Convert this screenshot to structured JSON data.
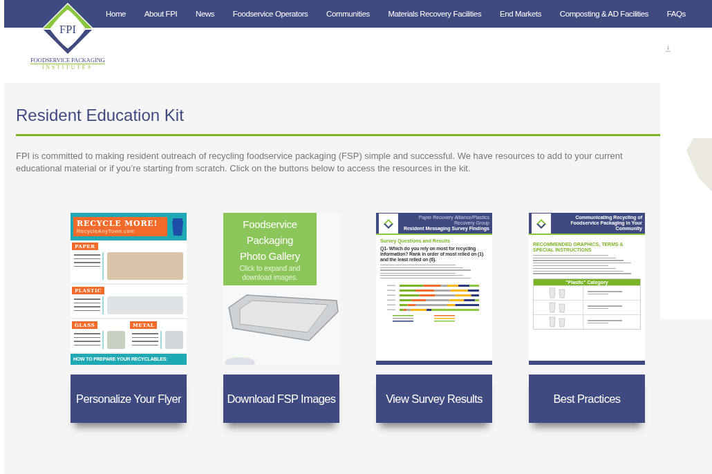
{
  "nav": {
    "logo": {
      "mark": "FPI",
      "name": "FOODSERVICE PACKAGING",
      "tagline": "INSTITUTE®"
    },
    "items": [
      "Home",
      "About FPI",
      "News",
      "Foodservice Operators",
      "Communities",
      "Materials Recovery Facilities",
      "End Markets",
      "Composting & AD Facilities",
      "FAQs"
    ]
  },
  "page": {
    "title": "Resident Education Kit",
    "intro": "FPI is committed to making resident outreach of recycling foodservice packaging (FSP) simple and successful. We have resources to add to your current educational material or if you’re starting from scratch. Click on the buttons below to access the resources in the kit."
  },
  "cards": [
    {
      "kind": "flyer",
      "thumbnail": {
        "headline": "RECYCLE MORE!",
        "url": "RecycleAnyTown.com",
        "sections": [
          "PAPER",
          "PLASTIC",
          "GLASS",
          "METAL"
        ],
        "footer": "HOW TO PREPARE YOUR RECYCLABLES:"
      },
      "button": "Personalize Your Flyer"
    },
    {
      "kind": "gallery",
      "thumbnail": {
        "title": "Foodservice Packaging Photo Gallery",
        "subtitle": "Click to expand and download images."
      },
      "button": "Download FSP Images"
    },
    {
      "kind": "survey",
      "thumbnail": {
        "org": "Paper Recovery Alliance/Plastics Recovery Group",
        "title": "Resident Messaging Survey Findings",
        "heading": "Survey Questions and Results",
        "question": "Q1- Which do you rely on most for recycling information? Rank in order of most relied on (1) and the least relied on (6)."
      },
      "button": "View Survey Results"
    },
    {
      "kind": "guide",
      "thumbnail": {
        "title": "Communicating Recycling of Foodservice Packaging in Your Community",
        "heading": "RECOMMENDED GRAPHICS, TERMS & SPECIAL INSTRUCTIONS",
        "table_title": "\"Plastic\" Category"
      },
      "button": "Best Practices"
    }
  ]
}
